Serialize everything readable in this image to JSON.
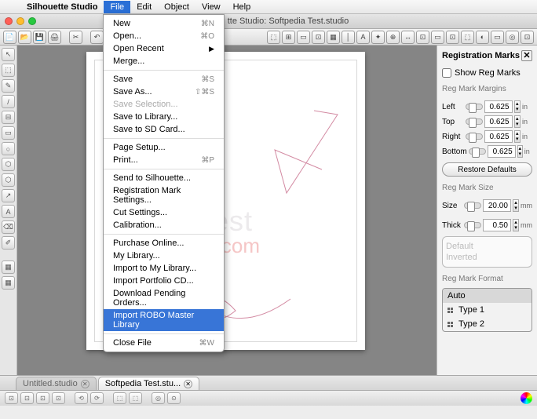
{
  "menubar": {
    "app": "Silhouette Studio",
    "items": [
      "File",
      "Edit",
      "Object",
      "View",
      "Help"
    ]
  },
  "window": {
    "title": "tte Studio: Softpedia Test.studio"
  },
  "file_menu": {
    "groups": [
      [
        {
          "label": "New",
          "shortcut": "⌘N"
        },
        {
          "label": "Open...",
          "shortcut": "⌘O"
        },
        {
          "label": "Open Recent",
          "submenu": true
        },
        {
          "label": "Merge..."
        }
      ],
      [
        {
          "label": "Save",
          "shortcut": "⌘S"
        },
        {
          "label": "Save As...",
          "shortcut": "⇧⌘S"
        },
        {
          "label": "Save Selection...",
          "disabled": true
        },
        {
          "label": "Save to Library..."
        },
        {
          "label": "Save to SD Card..."
        }
      ],
      [
        {
          "label": "Page Setup..."
        },
        {
          "label": "Print...",
          "shortcut": "⌘P"
        }
      ],
      [
        {
          "label": "Send to Silhouette..."
        },
        {
          "label": "Registration Mark Settings..."
        },
        {
          "label": "Cut Settings..."
        },
        {
          "label": "Calibration..."
        }
      ],
      [
        {
          "label": "Purchase Online..."
        },
        {
          "label": "My Library..."
        },
        {
          "label": "Import to My Library..."
        },
        {
          "label": "Import Portfolio CD..."
        },
        {
          "label": "Download Pending Orders..."
        },
        {
          "label": "Import ROBO Master Library",
          "highlight": true
        }
      ],
      [
        {
          "label": "Close File",
          "shortcut": "⌘W"
        }
      ]
    ]
  },
  "panel": {
    "title": "Registration Marks",
    "show_checkbox": "Show Reg Marks",
    "margins_label": "Reg Mark Margins",
    "margins": [
      {
        "name": "Left",
        "value": "0.625",
        "unit": "in"
      },
      {
        "name": "Top",
        "value": "0.625",
        "unit": "in"
      },
      {
        "name": "Right",
        "value": "0.625",
        "unit": "in"
      },
      {
        "name": "Bottom",
        "value": "0.625",
        "unit": "in"
      }
    ],
    "restore_btn": "Restore Defaults",
    "size_label": "Reg Mark Size",
    "size": {
      "name": "Size",
      "value": "20.00",
      "unit": "mm"
    },
    "thick": {
      "name": "Thick",
      "value": "0.50",
      "unit": "mm"
    },
    "preview": {
      "a": "Default",
      "b": "Inverted"
    },
    "format_label": "Reg Mark Format",
    "formats": [
      "Auto",
      "Type 1",
      "Type 2"
    ]
  },
  "tabs": [
    {
      "label": "Untitled.studio",
      "active": false
    },
    {
      "label": "Softpedia Test.stu...",
      "active": true
    }
  ],
  "watermark": {
    "a": "test",
    "b": "dia.com"
  },
  "toolbar_icons_left": [
    "📄",
    "📂",
    "💾",
    "🖨",
    "✂",
    "↶",
    "↷"
  ],
  "toolbar_icons_right": [
    "⬚",
    "⊞",
    "▭",
    "⊡",
    "▦",
    "│",
    "A",
    "✦",
    "⊕",
    "↔",
    "⊡",
    "▭",
    "⊡",
    "⬚",
    "◐",
    "▭",
    "◎",
    "⊡"
  ],
  "left_tools": [
    "↖",
    "⬚",
    "✎",
    "/",
    "⊟",
    "▭",
    "○",
    "⬡",
    "⬡",
    "↗",
    "A",
    "⌫",
    "✐"
  ],
  "left_tools2": [
    "▦",
    "▦"
  ],
  "bottom_icons": [
    "⊡",
    "⊡",
    "⊡",
    "⊡",
    "⟲",
    "⟳",
    "⬚",
    "⬚",
    "◎",
    "⊙"
  ]
}
